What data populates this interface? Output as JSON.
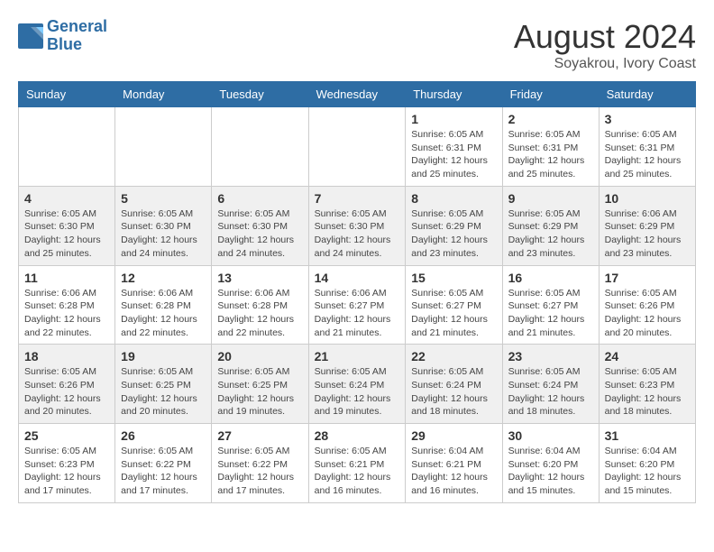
{
  "header": {
    "logo_line1": "General",
    "logo_line2": "Blue",
    "main_title": "August 2024",
    "sub_title": "Soyakrou, Ivory Coast"
  },
  "days_of_week": [
    "Sunday",
    "Monday",
    "Tuesday",
    "Wednesday",
    "Thursday",
    "Friday",
    "Saturday"
  ],
  "weeks": [
    [
      {
        "day": "",
        "info": ""
      },
      {
        "day": "",
        "info": ""
      },
      {
        "day": "",
        "info": ""
      },
      {
        "day": "",
        "info": ""
      },
      {
        "day": "1",
        "info": "Sunrise: 6:05 AM\nSunset: 6:31 PM\nDaylight: 12 hours\nand 25 minutes."
      },
      {
        "day": "2",
        "info": "Sunrise: 6:05 AM\nSunset: 6:31 PM\nDaylight: 12 hours\nand 25 minutes."
      },
      {
        "day": "3",
        "info": "Sunrise: 6:05 AM\nSunset: 6:31 PM\nDaylight: 12 hours\nand 25 minutes."
      }
    ],
    [
      {
        "day": "4",
        "info": "Sunrise: 6:05 AM\nSunset: 6:30 PM\nDaylight: 12 hours\nand 25 minutes."
      },
      {
        "day": "5",
        "info": "Sunrise: 6:05 AM\nSunset: 6:30 PM\nDaylight: 12 hours\nand 24 minutes."
      },
      {
        "day": "6",
        "info": "Sunrise: 6:05 AM\nSunset: 6:30 PM\nDaylight: 12 hours\nand 24 minutes."
      },
      {
        "day": "7",
        "info": "Sunrise: 6:05 AM\nSunset: 6:30 PM\nDaylight: 12 hours\nand 24 minutes."
      },
      {
        "day": "8",
        "info": "Sunrise: 6:05 AM\nSunset: 6:29 PM\nDaylight: 12 hours\nand 23 minutes."
      },
      {
        "day": "9",
        "info": "Sunrise: 6:05 AM\nSunset: 6:29 PM\nDaylight: 12 hours\nand 23 minutes."
      },
      {
        "day": "10",
        "info": "Sunrise: 6:06 AM\nSunset: 6:29 PM\nDaylight: 12 hours\nand 23 minutes."
      }
    ],
    [
      {
        "day": "11",
        "info": "Sunrise: 6:06 AM\nSunset: 6:28 PM\nDaylight: 12 hours\nand 22 minutes."
      },
      {
        "day": "12",
        "info": "Sunrise: 6:06 AM\nSunset: 6:28 PM\nDaylight: 12 hours\nand 22 minutes."
      },
      {
        "day": "13",
        "info": "Sunrise: 6:06 AM\nSunset: 6:28 PM\nDaylight: 12 hours\nand 22 minutes."
      },
      {
        "day": "14",
        "info": "Sunrise: 6:06 AM\nSunset: 6:27 PM\nDaylight: 12 hours\nand 21 minutes."
      },
      {
        "day": "15",
        "info": "Sunrise: 6:05 AM\nSunset: 6:27 PM\nDaylight: 12 hours\nand 21 minutes."
      },
      {
        "day": "16",
        "info": "Sunrise: 6:05 AM\nSunset: 6:27 PM\nDaylight: 12 hours\nand 21 minutes."
      },
      {
        "day": "17",
        "info": "Sunrise: 6:05 AM\nSunset: 6:26 PM\nDaylight: 12 hours\nand 20 minutes."
      }
    ],
    [
      {
        "day": "18",
        "info": "Sunrise: 6:05 AM\nSunset: 6:26 PM\nDaylight: 12 hours\nand 20 minutes."
      },
      {
        "day": "19",
        "info": "Sunrise: 6:05 AM\nSunset: 6:25 PM\nDaylight: 12 hours\nand 20 minutes."
      },
      {
        "day": "20",
        "info": "Sunrise: 6:05 AM\nSunset: 6:25 PM\nDaylight: 12 hours\nand 19 minutes."
      },
      {
        "day": "21",
        "info": "Sunrise: 6:05 AM\nSunset: 6:24 PM\nDaylight: 12 hours\nand 19 minutes."
      },
      {
        "day": "22",
        "info": "Sunrise: 6:05 AM\nSunset: 6:24 PM\nDaylight: 12 hours\nand 18 minutes."
      },
      {
        "day": "23",
        "info": "Sunrise: 6:05 AM\nSunset: 6:24 PM\nDaylight: 12 hours\nand 18 minutes."
      },
      {
        "day": "24",
        "info": "Sunrise: 6:05 AM\nSunset: 6:23 PM\nDaylight: 12 hours\nand 18 minutes."
      }
    ],
    [
      {
        "day": "25",
        "info": "Sunrise: 6:05 AM\nSunset: 6:23 PM\nDaylight: 12 hours\nand 17 minutes."
      },
      {
        "day": "26",
        "info": "Sunrise: 6:05 AM\nSunset: 6:22 PM\nDaylight: 12 hours\nand 17 minutes."
      },
      {
        "day": "27",
        "info": "Sunrise: 6:05 AM\nSunset: 6:22 PM\nDaylight: 12 hours\nand 17 minutes."
      },
      {
        "day": "28",
        "info": "Sunrise: 6:05 AM\nSunset: 6:21 PM\nDaylight: 12 hours\nand 16 minutes."
      },
      {
        "day": "29",
        "info": "Sunrise: 6:04 AM\nSunset: 6:21 PM\nDaylight: 12 hours\nand 16 minutes."
      },
      {
        "day": "30",
        "info": "Sunrise: 6:04 AM\nSunset: 6:20 PM\nDaylight: 12 hours\nand 15 minutes."
      },
      {
        "day": "31",
        "info": "Sunrise: 6:04 AM\nSunset: 6:20 PM\nDaylight: 12 hours\nand 15 minutes."
      }
    ]
  ]
}
